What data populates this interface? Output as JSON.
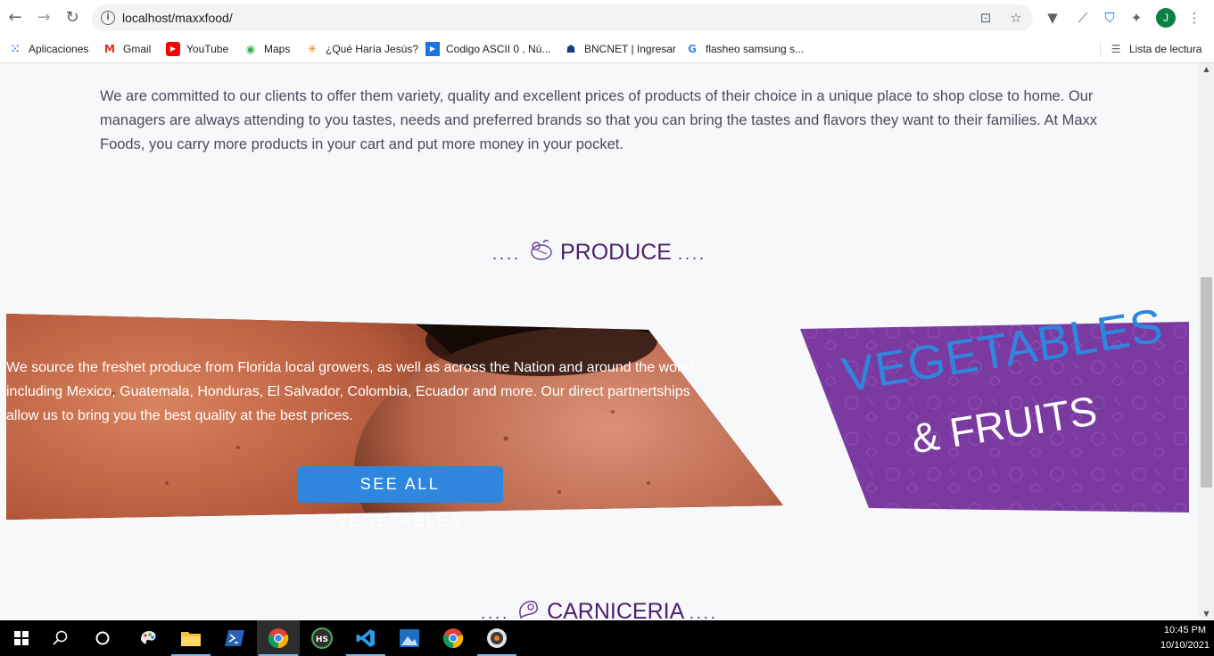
{
  "browser": {
    "url": "localhost/maxxfood/",
    "bookmarks": [
      {
        "label": "Aplicaciones",
        "icon": "apps-grid-icon"
      },
      {
        "label": "Gmail",
        "icon": "gmail-icon"
      },
      {
        "label": "YouTube",
        "icon": "youtube-icon"
      },
      {
        "label": "Maps",
        "icon": "maps-pin-icon"
      },
      {
        "label": "¿Qué Haría Jesús?",
        "icon": "sparkle-icon"
      },
      {
        "label": "Codigo ASCII 0 , Nú...",
        "icon": "play-square-icon"
      },
      {
        "label": "BNCNET | Ingresar",
        "icon": "bank-icon"
      },
      {
        "label": "flasheo samsung s...",
        "icon": "google-icon"
      }
    ],
    "reading_list": "Lista de lectura",
    "profile_initial": "J"
  },
  "page": {
    "intro_text": "We are committed to our clients to offer them variety, quality and excellent prices of products of their choice in a unique place to shop close to home. Our managers are always attending to you tastes, needs and preferred brands so that you can bring the tastes and flavors they want to their families. At Maxx Foods, you carry more products in your cart and put more money in your pocket.",
    "produce": {
      "dots_left": "....",
      "title": "PRODUCE",
      "dots_right": "....",
      "description": "We source the freshet produce from Florida local growers, as well as across the Nation and around the world, including Mexico, Guatemala, Honduras, El Salvador, Colombia, Ecuador and more. Our direct partnertships allow us to bring you the best quality at the best prices.",
      "button_label": "SEE ALL VEGETABLES",
      "banner_line1": "VEGETABLES",
      "banner_line2": "& FRUITS"
    },
    "carniceria": {
      "dots_left": "....",
      "title": "CARNICERIA",
      "dots_right": "...."
    }
  },
  "taskbar": {
    "time": "10:45 PM",
    "date": "10/10/2021"
  },
  "colors": {
    "accent_purple": "#4b1f6e",
    "banner_purple": "#7b3aa0",
    "button_blue": "#2f86de"
  }
}
